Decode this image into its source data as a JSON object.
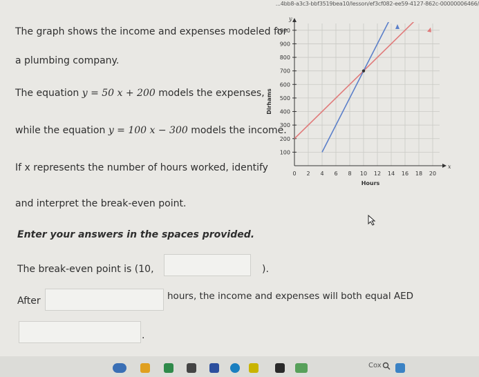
{
  "url_fragment": "...4bb8-a3c3-bbf3519bea10/lesson/ef3cf082-ee59-4127-862c-00000006466/",
  "question": {
    "line1": "The graph shows the income and expenses modeled for",
    "line2": "a plumbing company.",
    "line3_pre": "The equation ",
    "line3_eq": "y = 50 x + 200",
    "line3_post": " models the expenses,",
    "line4_pre": "while the equation ",
    "line4_eq": "y = 100 x − 300",
    "line4_post": " models the income.",
    "line5": "If x represents the number of hours worked, identify",
    "line6": "and interpret the break-even point."
  },
  "instructions": "Enter your answers in the spaces provided.",
  "answer1": {
    "pre": "The break-even point is (10,",
    "post": ")."
  },
  "answer2": {
    "pre": "After",
    "post": "hours, the income and expenses will both equal AED"
  },
  "answer3": {
    "post": "."
  },
  "chart_data": {
    "type": "line",
    "xlabel": "Hours",
    "ylabel": "Dirhams",
    "x_axis_letter": "x",
    "y_axis_letter": "y",
    "xlim": [
      0,
      21
    ],
    "ylim": [
      0,
      1050
    ],
    "xticks": [
      0,
      2,
      4,
      6,
      8,
      10,
      12,
      14,
      16,
      18,
      20
    ],
    "yticks": [
      100,
      200,
      300,
      400,
      500,
      600,
      700,
      800,
      900,
      1000
    ],
    "series": [
      {
        "equation": "y = 50x + 200",
        "color": "#e07a7a",
        "x": [
          0,
          21
        ],
        "y": [
          200,
          1250
        ]
      },
      {
        "equation": "y = 100x - 300",
        "color": "#5b7fc9",
        "x": [
          4,
          21
        ],
        "y": [
          100,
          1800
        ]
      }
    ],
    "points": [
      {
        "x": 10,
        "y": 700
      }
    ]
  },
  "taskbar": {
    "search_text": "Cox",
    "colors": [
      "#3a6fb5",
      "#e0a020",
      "#2f8a4a",
      "#444444",
      "#2c4f9e",
      "#1a7fc0",
      "#c9b400",
      "#2a2a2a",
      "#57a05a",
      "#3b82c4"
    ]
  }
}
